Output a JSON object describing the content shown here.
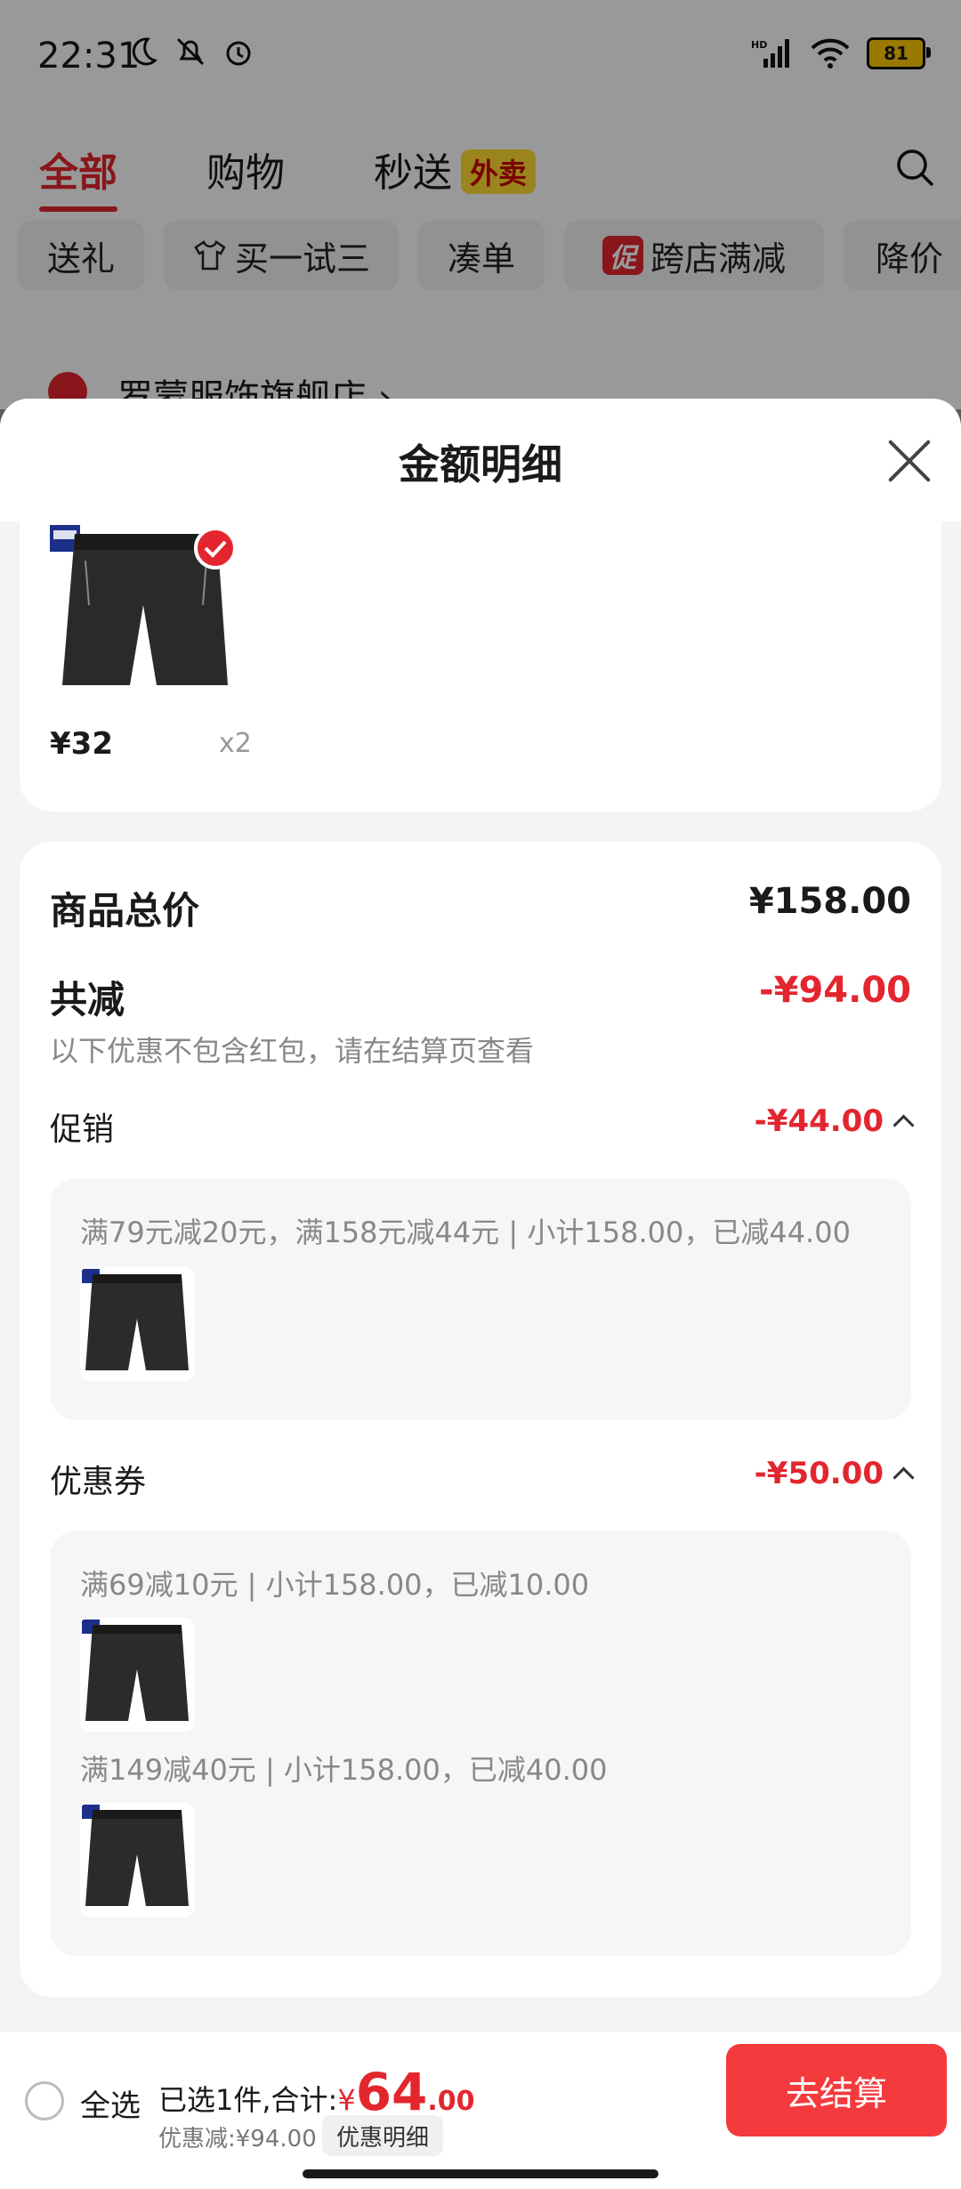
{
  "status_bar": {
    "time": "22:31",
    "battery": "81",
    "icons_left": [
      "moon-icon",
      "bell-off-icon",
      "alarm-icon"
    ],
    "icons_right": [
      "hd-signal-icon",
      "wifi-icon",
      "battery-icon"
    ]
  },
  "top_tabs": {
    "all": "全部",
    "shopping": "购物",
    "fast_delivery": "秒送",
    "takeout_badge": "外卖"
  },
  "chips": [
    "送礼",
    "买一试三",
    "凑单",
    "跨店满减",
    "降价"
  ],
  "chip_badge": "促",
  "store": {
    "name": "罗蒙服饰旗舰店 ›"
  },
  "sheet": {
    "title": "金额明细",
    "goods": {
      "price": "¥32",
      "qty": "x2"
    },
    "total_label": "商品总价",
    "total_value": "¥158.00",
    "cut_label": "共减",
    "cut_value": "-¥94.00",
    "note": "以下优惠不包含红包，请在结算页查看",
    "promo": {
      "label": "促销",
      "value": "-¥44.00",
      "line": "满79元减20元，满158元减44元 | 小计158.00，已减44.00"
    },
    "coupon": {
      "label": "优惠券",
      "value": "-¥50.00",
      "line1": "满69减10元 | 小计158.00，已减10.00",
      "line2": "满149减40元 | 小计158.00，已减40.00"
    }
  },
  "bottom_bar": {
    "select_all": "全选",
    "summary_prefix": "已选1件,合计:",
    "currency": "¥",
    "amount_int": "64",
    "amount_dec": ".00",
    "discount_text": "优惠减:¥94.00",
    "discount_detail": "优惠明细",
    "checkout": "去结算"
  },
  "colors": {
    "accent": "#e3262e",
    "checkout": "#f43a3d",
    "takeout_badge": "#ffdd33"
  }
}
